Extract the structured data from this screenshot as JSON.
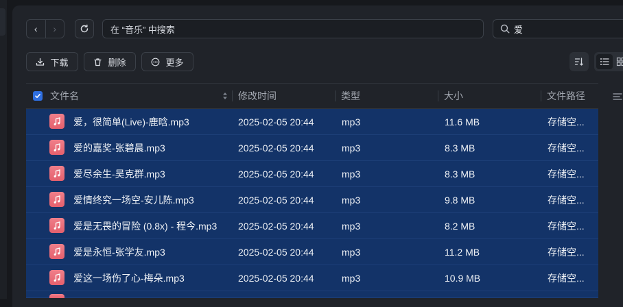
{
  "nav": {
    "back_glyph": "‹",
    "forward_glyph": "›"
  },
  "path_bar": {
    "text": "在 “音乐” 中搜索"
  },
  "search": {
    "value": "爱"
  },
  "toolbar": {
    "download": "下载",
    "delete": "删除",
    "more": "更多"
  },
  "columns": {
    "name": "文件名",
    "modified": "修改时间",
    "type": "类型",
    "size": "大小",
    "path": "文件路径"
  },
  "files": [
    {
      "name": "爱，很简单(Live)-鹿晗.mp3",
      "modified": "2025-02-05 20:44",
      "type": "mp3",
      "size": "11.6 MB",
      "path": "存储空..."
    },
    {
      "name": "爱的嘉奖-张碧晨.mp3",
      "modified": "2025-02-05 20:44",
      "type": "mp3",
      "size": "8.3 MB",
      "path": "存储空..."
    },
    {
      "name": "爱尽余生-吴克群.mp3",
      "modified": "2025-02-05 20:44",
      "type": "mp3",
      "size": "8.3 MB",
      "path": "存储空..."
    },
    {
      "name": "爱情终究一场空-安儿陈.mp3",
      "modified": "2025-02-05 20:44",
      "type": "mp3",
      "size": "9.8 MB",
      "path": "存储空..."
    },
    {
      "name": "爱是无畏的冒险 (0.8x) - 程今.mp3",
      "modified": "2025-02-05 20:44",
      "type": "mp3",
      "size": "8.2 MB",
      "path": "存储空..."
    },
    {
      "name": "爱是永恒-张学友.mp3",
      "modified": "2025-02-05 20:44",
      "type": "mp3",
      "size": "11.2 MB",
      "path": "存储空..."
    },
    {
      "name": "爱这一场伤了心-梅朵.mp3",
      "modified": "2025-02-05 20:44",
      "type": "mp3",
      "size": "10.9 MB",
      "path": "存储空..."
    }
  ],
  "colors": {
    "selected_row": "#133368",
    "accent": "#2f6fe0",
    "file_icon": "#e4606d"
  },
  "icons": {
    "file_type": "music-note-icon"
  }
}
